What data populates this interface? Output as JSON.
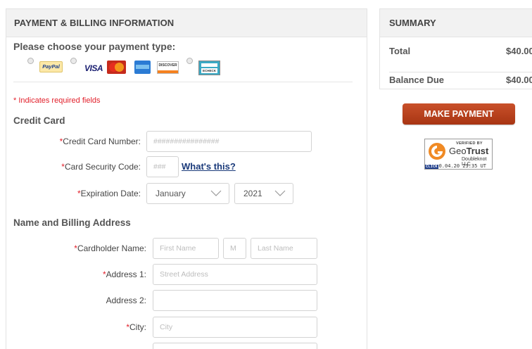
{
  "billing": {
    "header": "PAYMENT & BILLING INFORMATION",
    "payment_type_title": "Please choose your payment type:",
    "payment_options": [
      {
        "name": "PayPal",
        "logo_text": "PayPal",
        "icon": "paypal-logo"
      },
      {
        "name": "Cards",
        "logos": [
          {
            "text": "VISA",
            "icon": "visa-logo"
          },
          {
            "text": "MasterCard",
            "icon": "mastercard-logo"
          },
          {
            "text": "",
            "icon": "amex-logo"
          },
          {
            "text": "DISCOVER",
            "icon": "discover-logo"
          }
        ]
      },
      {
        "name": "eCheck",
        "logo_text": "ECHECK",
        "icon": "echeck-logo"
      }
    ],
    "required_note": "* Indicates required fields",
    "credit_card_title": "Credit Card",
    "card_number": {
      "label": "Credit Card Number:",
      "required_mark": "*",
      "placeholder": "################"
    },
    "security_code": {
      "label": "Card Security Code:",
      "required_mark": "*",
      "placeholder": "###"
    },
    "whats_this": "What's this?",
    "expiration": {
      "label": "Expiration Date:",
      "required_mark": "*",
      "month": "January",
      "year": "2021"
    },
    "address_title": "Name and Billing Address",
    "cardholder": {
      "label": "Cardholder Name:",
      "required_mark": "*",
      "first_placeholder": "First Name",
      "middle_placeholder": "M",
      "last_placeholder": "Last Name"
    },
    "address1": {
      "label": "Address 1:",
      "required_mark": "*",
      "placeholder": "Street Address"
    },
    "address2": {
      "label": "Address 2:",
      "value": ""
    },
    "city": {
      "label": "City:",
      "required_mark": "*",
      "placeholder": "City"
    }
  },
  "summary": {
    "header": "SUMMARY",
    "total_label": "Total",
    "total_value": "$40.00",
    "balance_label": "Balance Due",
    "balance_value": "$40.00",
    "make_payment": "MAKE PAYMENT"
  },
  "seal": {
    "verified": "VERIFIED BY",
    "brand_a": "Geo",
    "brand_b": "Trust",
    "org": "Doubleknot LLC",
    "click": "CLICK",
    "date": "0.04.20 23:35 UT"
  },
  "colors": {
    "accent_button": "#b53f1c",
    "required": "#e2202b",
    "link": "#1a3a7a"
  }
}
